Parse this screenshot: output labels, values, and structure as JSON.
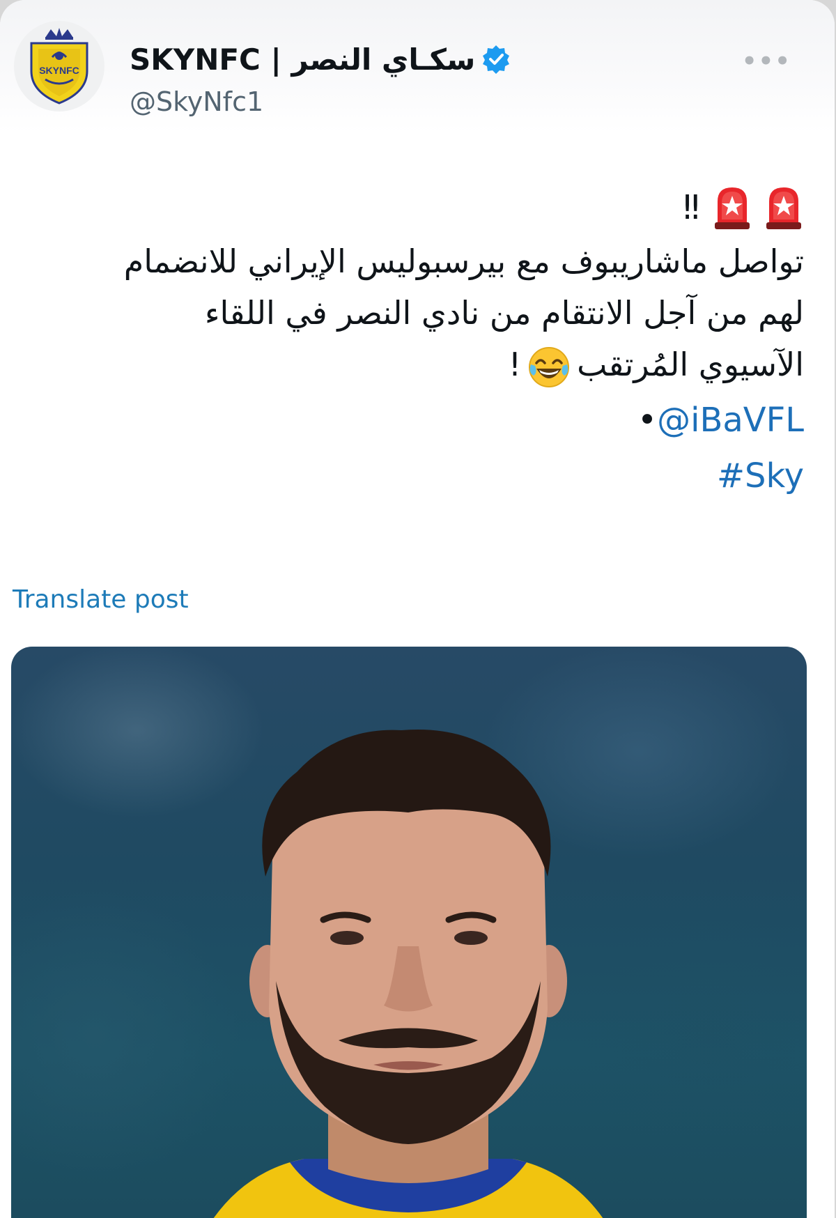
{
  "tweet": {
    "author": {
      "display_name": "SKYNFC | سكـاي النصر",
      "handle": "@SkyNfc1",
      "verified": true,
      "avatar_logo_text": "SKYNFC"
    },
    "more_menu": "•••",
    "alert_emojis": [
      "rotating-light",
      "rotating-light"
    ],
    "alert_mark": "‼",
    "body_lines": [
      "تواصل ماشاريبوف مع بيرسبوليس الإيراني للانضمام",
      "لهم من آجل الانتقام من نادي النصر  في اللقاء",
      "الآسيوي المُرتقب"
    ],
    "body_end_emoji": "face-with-tears-of-joy",
    "body_end_punct": "!",
    "mention_bullet": "•",
    "mention": "@iBaVFL",
    "hashtag": "#Sky",
    "translate_label": "Translate post"
  },
  "colors": {
    "link": "#1d6fb8",
    "verified_badge": "#1d9bf0",
    "text": "#0f1419",
    "muted": "#536471"
  }
}
